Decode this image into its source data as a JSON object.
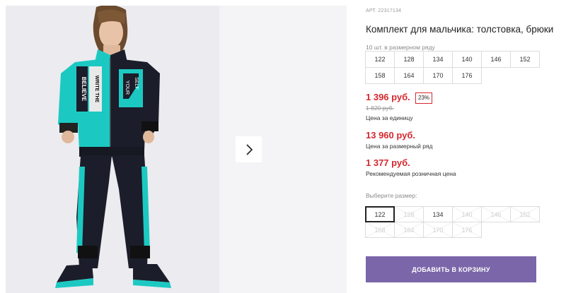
{
  "product": {
    "article": "АРТ. 22317134",
    "title": "Комплект для мальчика: толстовка, брюки",
    "pack_info": "10 шт. в размерном ряду",
    "pack_sizes": [
      "122",
      "128",
      "134",
      "140",
      "146",
      "152",
      "158",
      "164",
      "170",
      "176"
    ]
  },
  "prices": {
    "unit_price": "1 396 руб.",
    "discount": "23%",
    "old_price": "1 820 руб.",
    "unit_label": "Цена за единицу",
    "row_price": "13 960 руб.",
    "row_label": "Цена за размерный ряд",
    "retail_price": "1 377 руб.",
    "retail_label": "Рекомендуемая розничная цена"
  },
  "size_picker": {
    "label": "Выберите размер:",
    "options": [
      {
        "label": "122",
        "state": "selected"
      },
      {
        "label": "128",
        "state": "disabled"
      },
      {
        "label": "134",
        "state": "available"
      },
      {
        "label": "140",
        "state": "disabled"
      },
      {
        "label": "146",
        "state": "disabled"
      },
      {
        "label": "152",
        "state": "disabled"
      },
      {
        "label": "158",
        "state": "disabled"
      },
      {
        "label": "164",
        "state": "disabled"
      },
      {
        "label": "170",
        "state": "disabled"
      },
      {
        "label": "176",
        "state": "disabled"
      }
    ]
  },
  "actions": {
    "add_to_cart": "ДОБАВИТЬ В КОРЗИНУ"
  },
  "photo_print": {
    "line1": "BELIEVE",
    "line2": "WRITE THE",
    "line3": "YOUR",
    "line4": "SELF"
  },
  "colors": {
    "accent_price": "#d5282f",
    "button": "#7a66a8",
    "garment_teal": "#1cc9c2",
    "garment_black": "#1b1d2a"
  },
  "icons": {
    "next": "chevron-right-icon"
  }
}
